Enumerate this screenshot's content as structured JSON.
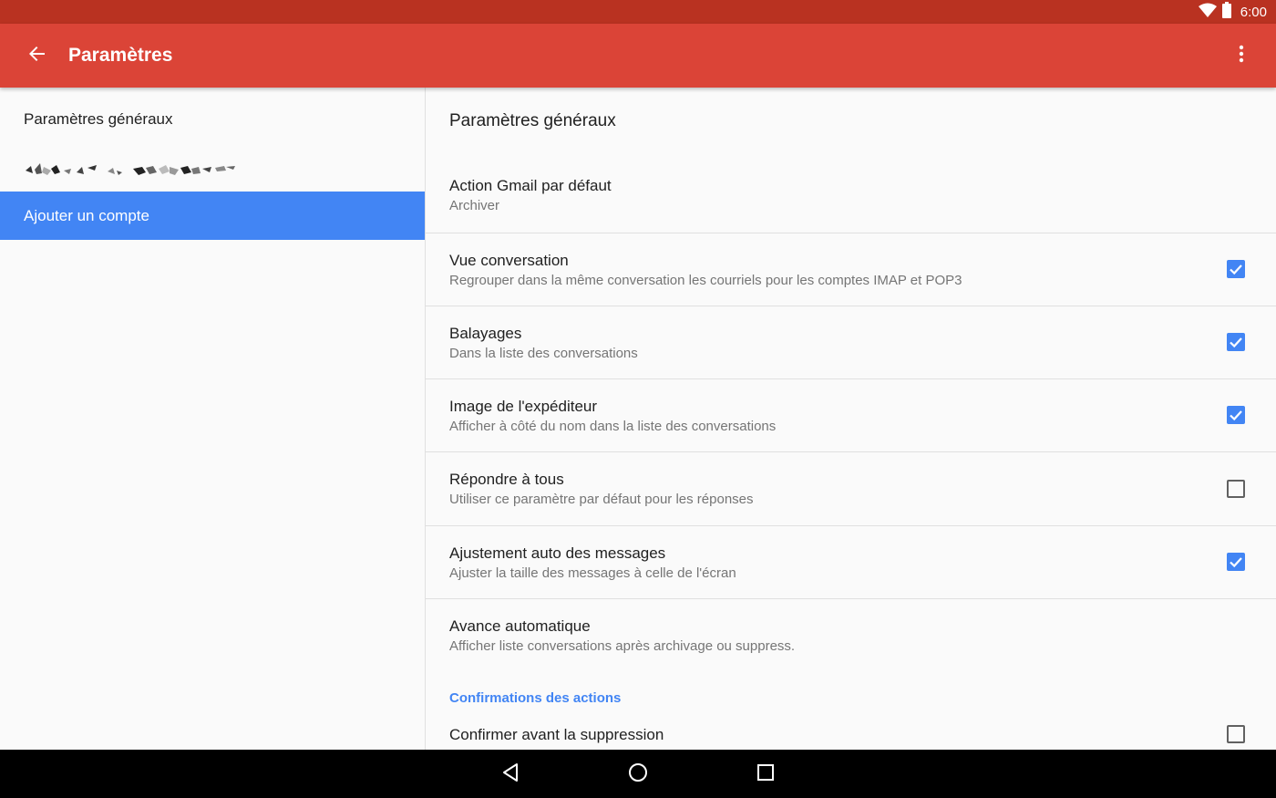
{
  "status_bar": {
    "time": "6:00",
    "icons": [
      "wifi-icon",
      "battery-icon"
    ]
  },
  "app_bar": {
    "title": "Paramètres",
    "back_icon": "arrow-back-icon",
    "menu_icon": "more-vert-icon"
  },
  "sidebar": {
    "items": [
      {
        "label": "Paramètres généraux"
      },
      {
        "label": "",
        "redacted": true
      },
      {
        "label": "Ajouter un compte",
        "selected": true
      }
    ]
  },
  "main": {
    "heading": "Paramètres généraux",
    "prefs": [
      {
        "title": "Action Gmail par défaut",
        "summary": "Archiver"
      },
      {
        "title": "Vue conversation",
        "summary": "Regrouper dans la même conversation les courriels pour les comptes IMAP et POP3",
        "checked": true
      },
      {
        "title": "Balayages",
        "summary": "Dans la liste des conversations",
        "checked": true
      },
      {
        "title": "Image de l'expéditeur",
        "summary": "Afficher à côté du nom dans la liste des conversations",
        "checked": true
      },
      {
        "title": "Répondre à tous",
        "summary": "Utiliser ce paramètre par défaut pour les réponses",
        "checked": false
      },
      {
        "title": "Ajustement auto des messages",
        "summary": "Ajuster la taille des messages à celle de l'écran",
        "checked": true
      },
      {
        "title": "Avance automatique",
        "summary": "Afficher liste conversations après archivage ou suppress."
      }
    ],
    "category": "Confirmations des actions",
    "confirm_pref": {
      "title": "Confirmer avant la suppression",
      "checked": false
    }
  },
  "nav_bar": {
    "buttons": [
      "back-triangle-icon",
      "home-circle-icon",
      "recents-square-icon"
    ]
  },
  "colors": {
    "status_bar": "#b93221",
    "app_bar": "#db4437",
    "accent": "#4285f4",
    "summary_text": "#757575",
    "divider": "#e0e0e0"
  }
}
